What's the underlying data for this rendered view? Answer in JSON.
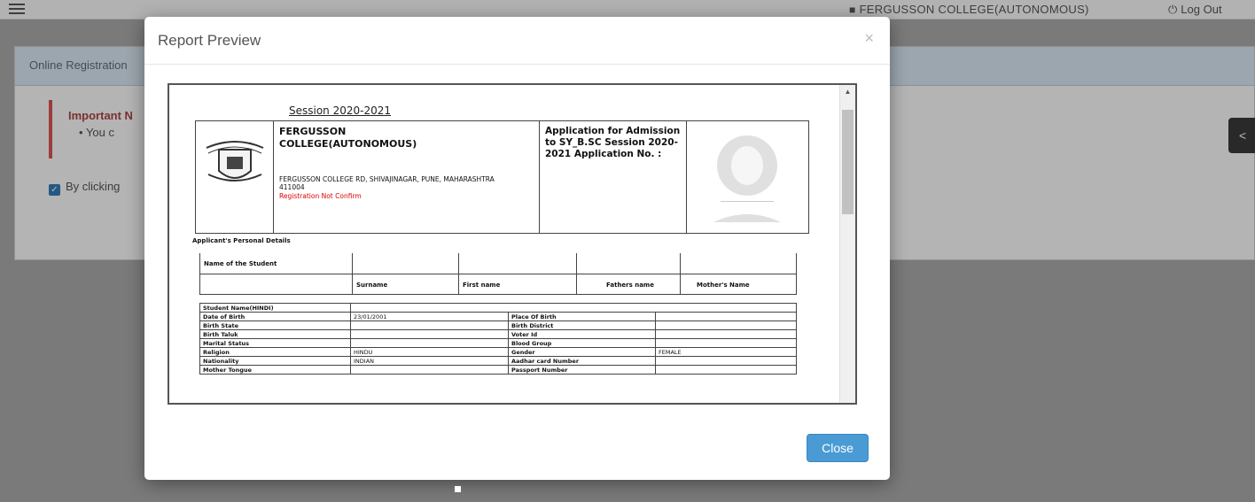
{
  "topbar": {
    "college": "FERGUSSON COLLEGE(AUTONOMOUS)",
    "logout": "Log Out"
  },
  "background": {
    "panel_title": "Online Registration",
    "notice_title": "Important N",
    "notice_item": "You c",
    "agree_text": "By clicking"
  },
  "modal": {
    "title": "Report Preview",
    "close_x": "×",
    "close_button": "Close"
  },
  "document": {
    "session": "Session 2020-2021",
    "college_name": "FERGUSSON COLLEGE(AUTONOMOUS)",
    "college_address": "FERGUSSON COLLEGE RD, SHIVAJINAGAR, PUNE, MAHARASHTRA 411004",
    "registration_status": "Registration Not Confirm",
    "application_for": "Application for Admission to SY_B.SC Session 2020-2021 Application No. :",
    "personal_details": "Applicant's Personal Details",
    "name_label": "Name of the Student",
    "name_columns": [
      "Surname",
      "First name",
      "Fathers name",
      "Mother's Name"
    ],
    "student_name_label": "Student Name(HINDI)",
    "rows": [
      [
        "Date of Birth",
        "23/01/2001",
        "Place Of Birth",
        ""
      ],
      [
        "Birth State",
        "",
        "Birth District",
        ""
      ],
      [
        "Birth Taluk",
        "",
        "Voter Id",
        ""
      ],
      [
        "Marital Status",
        "",
        "Blood Group",
        ""
      ],
      [
        "Religion",
        "HINDU",
        "Gender",
        "FEMALE"
      ],
      [
        "Nationality",
        "INDIAN",
        "Aadhar card Number",
        ""
      ],
      [
        "Mother Tongue",
        "",
        "Passport Number",
        ""
      ]
    ]
  }
}
